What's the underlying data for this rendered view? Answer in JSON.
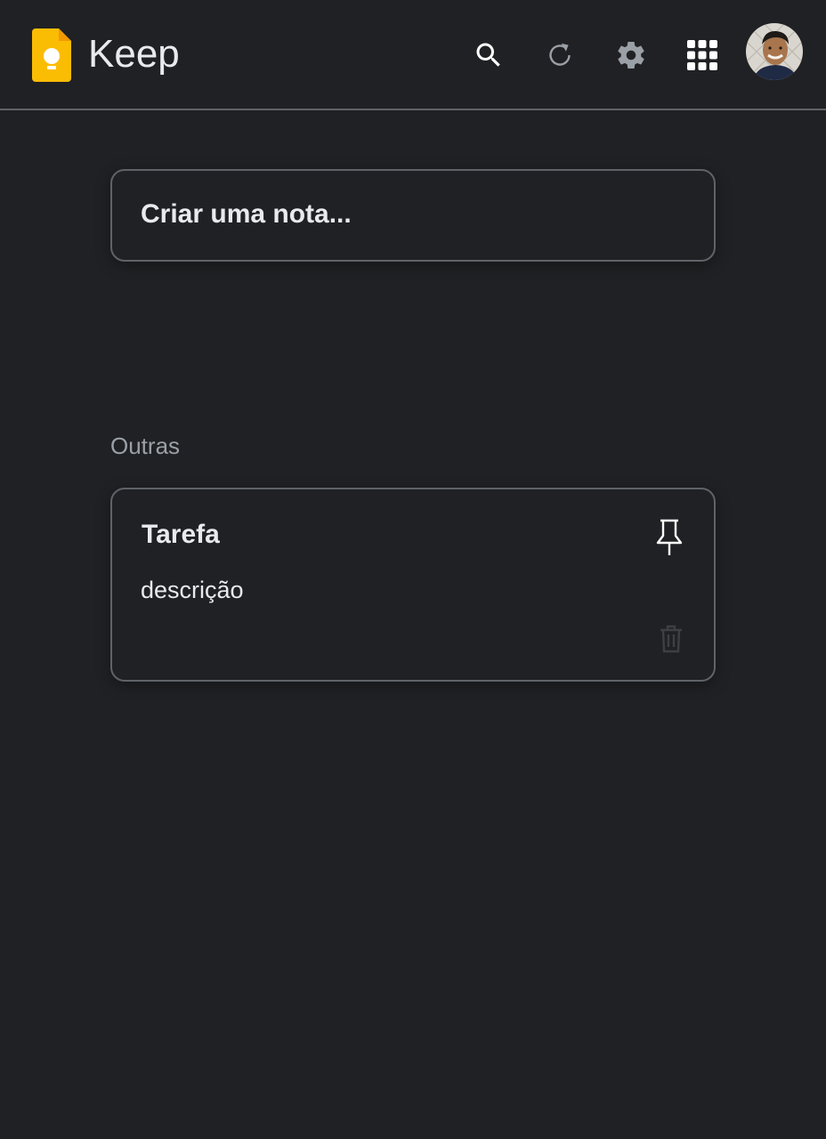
{
  "header": {
    "app_title": "Keep",
    "logo_icon": "keep-lightbulb-logo",
    "actions": [
      {
        "name": "search-icon"
      },
      {
        "name": "refresh-icon"
      },
      {
        "name": "settings-icon"
      },
      {
        "name": "apps-grid-icon"
      }
    ]
  },
  "create_note": {
    "placeholder": "Criar uma nota..."
  },
  "sections": {
    "others_label": "Outras"
  },
  "notes": [
    {
      "title": "Tarefa",
      "body": "descrição"
    }
  ],
  "colors": {
    "background": "#202124",
    "border": "#5f6368",
    "text": "#e8eaed",
    "muted_text": "#9aa0a6",
    "logo_yellow": "#fbbc04"
  }
}
